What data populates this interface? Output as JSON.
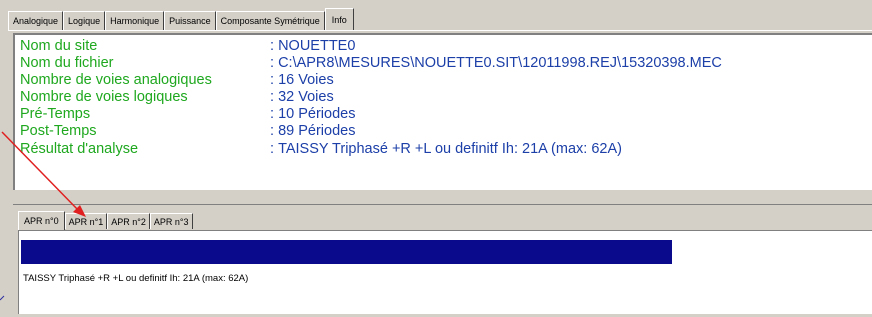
{
  "top_tabs": [
    {
      "label": "Analogique"
    },
    {
      "label": "Logique"
    },
    {
      "label": "Harmonique"
    },
    {
      "label": "Puissance"
    },
    {
      "label": "Composante Symétrique"
    },
    {
      "label": "Info"
    }
  ],
  "info": {
    "rows": [
      {
        "label": "Nom du site",
        "value": "NOUETTE0"
      },
      {
        "label": "Nom du fichier",
        "value": "C:\\APR8\\MESURES\\NOUETTE0.SIT\\12011998.REJ\\15320398.MEC"
      },
      {
        "label": "Nombre de voies analogiques",
        "value": "16 Voies"
      },
      {
        "label": "Nombre de voies logiques",
        "value": "32 Voies"
      },
      {
        "label": "Pré-Temps",
        "value": "10 Périodes"
      },
      {
        "label": "Post-Temps",
        "value": "89 Périodes"
      },
      {
        "label": "Résultat d'analyse",
        "value": "TAISSY    Triphasé +R  +L ou definitf Ih: 21A (max: 62A)"
      }
    ]
  },
  "apr_tabs": [
    {
      "label": "APR n°0"
    },
    {
      "label": "APR n°1"
    },
    {
      "label": "APR n°2"
    },
    {
      "label": "APR n°3"
    }
  ],
  "apr_panel": {
    "status_text": "TAISSY    Triphasé +R  +L ou definitf Ih: 21A (max: 62A)",
    "bar_color": "#0a0a8c"
  },
  "colors": {
    "label_green": "#1fa81f",
    "value_blue": "#1c3fa8",
    "annotation_red": "#e02020"
  }
}
